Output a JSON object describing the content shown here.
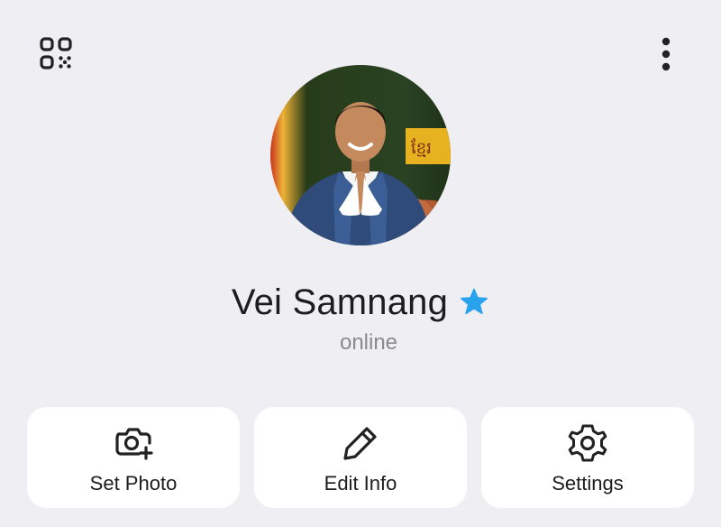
{
  "header": {
    "left_icon": "qr-code-icon",
    "right_icon": "more-vertical-icon"
  },
  "profile": {
    "name": "Vei Samnang",
    "status": "online",
    "badge_icon": "premium-star-icon",
    "badge_color": "#2aa3ef"
  },
  "actions": [
    {
      "label": "Set Photo",
      "icon": "camera-plus-icon"
    },
    {
      "label": "Edit Info",
      "icon": "pencil-icon"
    },
    {
      "label": "Settings",
      "icon": "gear-icon"
    }
  ],
  "colors": {
    "background": "#efeff3",
    "card": "#ffffff",
    "text": "#1c1c1e",
    "secondary_text": "#8a8a8f"
  }
}
